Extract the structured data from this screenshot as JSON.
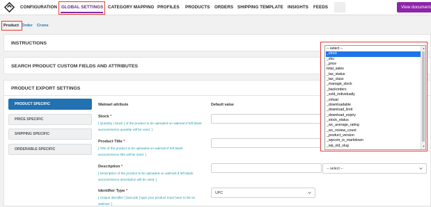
{
  "topnav": {
    "items": [
      "CONFIGURATION",
      "GLOBAL SETTINGS",
      "CATEGORY MAPPING",
      "PROFILES",
      "PRODUCTS",
      "ORDERS",
      "SHIPPING TEMPLATE",
      "INSIGHTS",
      "FEEDS"
    ],
    "view_button": "View documentation",
    "accent": "#8e24aa"
  },
  "subtabs": [
    "Product",
    "Order",
    "Crons"
  ],
  "sections": {
    "instructions": "INSTRUCTIONS",
    "search": "SEARCH PRODUCT CUSTOM FIELDS AND ATTRIBUTES",
    "export": "PRODUCT EXPORT SETTINGS"
  },
  "sidebar": [
    "PRODUCT SPECIFIC",
    "PRICE SPECIFIC",
    "SHIPPING SPECIFIC",
    "ORDERABLE SPECIFIC"
  ],
  "table": {
    "col_attribute": "Walmart attribute",
    "col_default": "Default value"
  },
  "fields": [
    {
      "label": "Stock",
      "req": "*",
      "desc": "[ Quantity | Stock ] of the product to be uploaded on walmart.If left blank woocommerce quantity will be used. ]"
    },
    {
      "label": "Product Title",
      "req": "*",
      "desc": "[ Title of the product to be uploaded on walmart.If left blank woocommerce title will be used. ]"
    },
    {
      "label": "Description",
      "req": "*",
      "desc": "[ Description of the product to be uploaded on walmart.If left blank woocommerce description will be used. ]"
    },
    {
      "label": "Identifier Type",
      "req": "*",
      "desc": "[ Unique identifier [ barcode ] type your product must have to list on walmart. ]"
    }
  ],
  "selects": {
    "description_map": "-- select --",
    "identifier_value": "UPC"
  },
  "dropdown": {
    "options": [
      "-- select --",
      "_stock",
      "_sku",
      "_price",
      "total_sales",
      "_tax_status",
      "_tax_class",
      "_manage_stock",
      "_backorders",
      "_sold_individually",
      "_virtual",
      "_downloadable",
      "_download_limit",
      "_download_expiry",
      "_stock_status",
      "_wc_average_rating",
      "_wc_review_count",
      "_product_version",
      "_wpcom_is_markdown",
      "_wp_old_slug"
    ],
    "selected": "_stock"
  }
}
